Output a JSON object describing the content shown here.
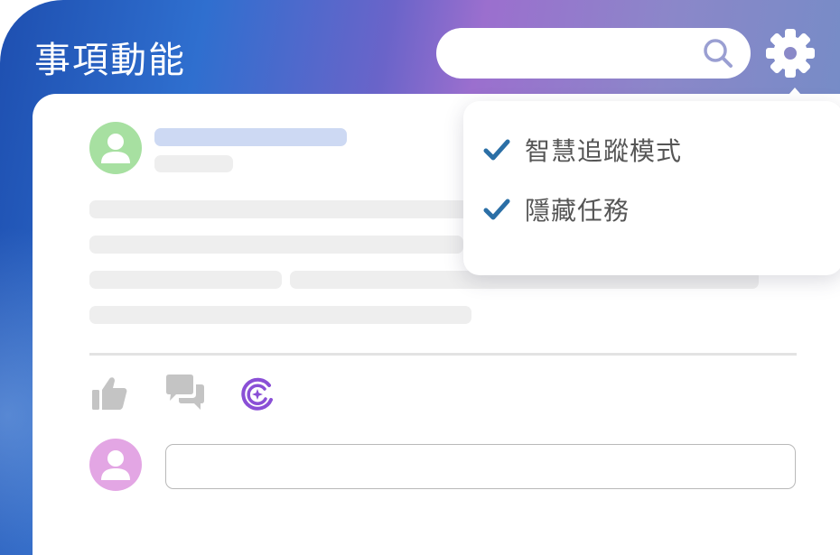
{
  "app": {
    "title": "事項動能"
  },
  "header": {
    "search": {
      "value": "",
      "placeholder": ""
    },
    "icons": {
      "search": "search-icon",
      "settings": "gear-icon"
    }
  },
  "settings_menu": {
    "items": [
      {
        "label": "智慧追蹤模式",
        "checked": true,
        "icon": "check-icon"
      },
      {
        "label": "隱藏任務",
        "checked": true,
        "icon": "check-icon"
      }
    ]
  },
  "post": {
    "actions": [
      {
        "icon": "thumbs-up-icon"
      },
      {
        "icon": "comment-icon"
      },
      {
        "icon": "ai-assistant-icon"
      }
    ],
    "comment_input": {
      "value": "",
      "placeholder": ""
    }
  },
  "colors": {
    "header_gradient": [
      "#1e4fb0",
      "#9b6fce",
      "#6e8ec6"
    ],
    "check": "#2b6fa6",
    "ai_accent": "#8a4fd6",
    "avatar_post": "#a7e0a1",
    "avatar_commenter": "#e3a6e4",
    "skeleton": "#eeeeee",
    "skeleton_highlight": "#cdd9f3"
  }
}
